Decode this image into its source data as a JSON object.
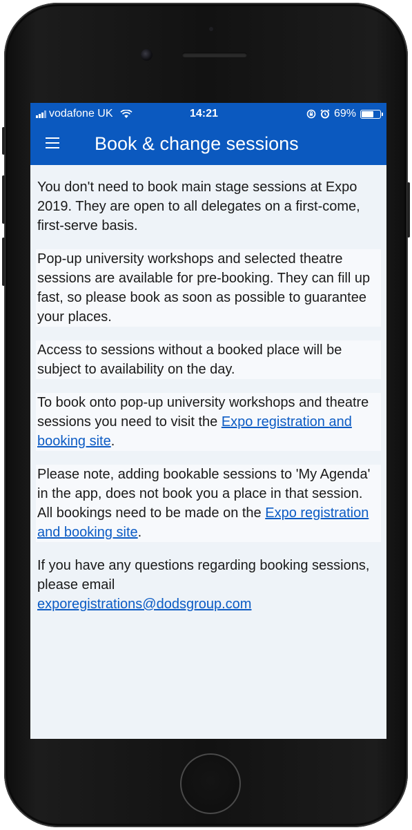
{
  "status_bar": {
    "carrier": "vodafone UK",
    "time": "14:21",
    "battery_percent": "69%",
    "battery_level": 0.69,
    "icons": [
      "signal-icon",
      "wifi-icon",
      "lock-rotation-icon",
      "alarm-icon",
      "battery-icon"
    ]
  },
  "header": {
    "title": "Book & change sessions",
    "menu_icon": "hamburger-menu-icon"
  },
  "content": {
    "p1": "You don't need to book main stage sessions at Expo 2019. They are open to all delegates on a first-come, first-serve basis.",
    "p2": "Pop-up university workshops and selected theatre sessions are available for pre-booking. They can fill up fast, so please book as soon as possible to guarantee your places.",
    "p3": "Access to sessions without a booked place will be subject to availability on the day.",
    "p4_text": "To book onto pop-up university workshops and theatre sessions you need to visit the ",
    "p4_link": "Expo registration and booking site",
    "p4_end": ".",
    "p5_text": "Please note, adding bookable sessions to 'My Agenda' in the app, does not book you a place in that session. All bookings need to be made on the ",
    "p5_link": "Expo registration and booking site",
    "p5_end": ".",
    "p6_text": "If you have any questions regarding booking sessions, please email",
    "p6_email": "exporegistrations@dodsgroup.com"
  },
  "colors": {
    "brand_blue": "#0b59bf",
    "link_blue": "#0b5bc4",
    "screen_bg": "#eef3f8"
  }
}
